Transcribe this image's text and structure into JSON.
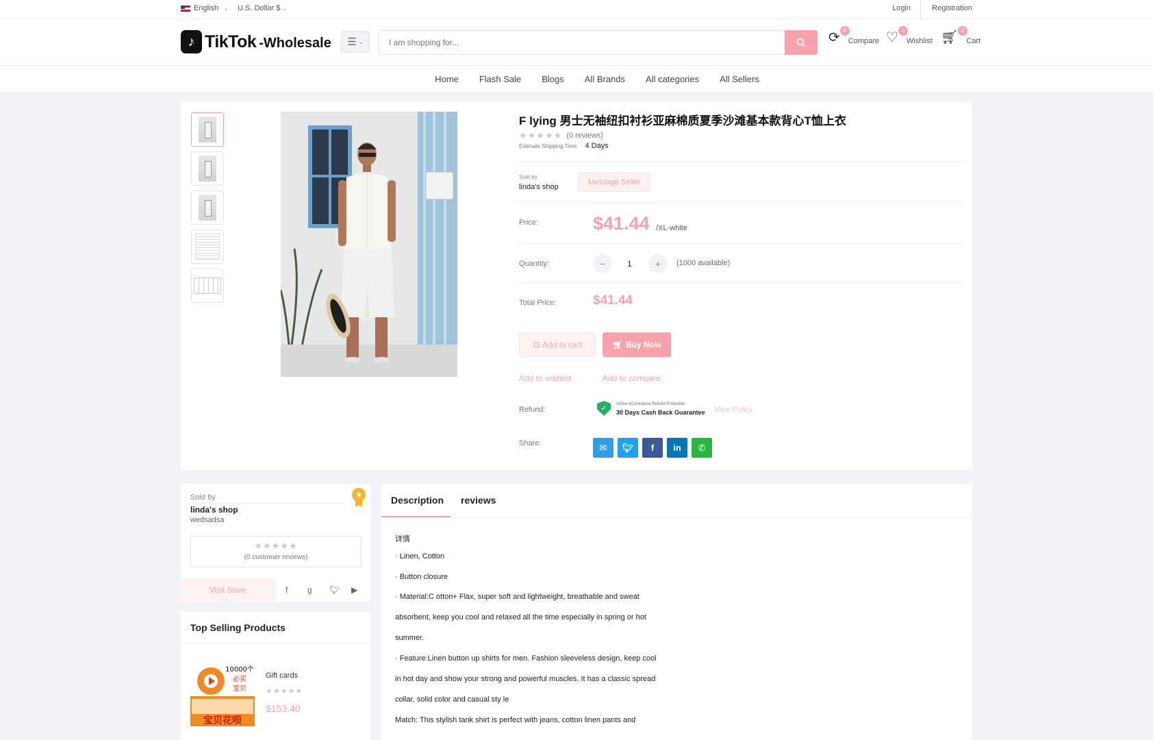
{
  "topbar": {
    "language": "English",
    "currency": "U.S. Dollar $",
    "login": "Login",
    "registration": "Registration"
  },
  "header": {
    "logo_main": "TikTok",
    "logo_sub": "-Wholesale",
    "search_placeholder": "I am shopping for...",
    "compare": {
      "label": "Compare",
      "count": "0"
    },
    "wishlist": {
      "label": "Wishlist",
      "count": "0"
    },
    "cart": {
      "label": "Cart",
      "count": "0"
    }
  },
  "nav": [
    "Home",
    "Flash Sale",
    "Blogs",
    "All Brands",
    "All categories",
    "All Sellers"
  ],
  "product": {
    "title": "F lying 男士无袖纽扣衬衫亚麻棉质夏季沙滩基本款背心T恤上衣",
    "stars": "★★★★★",
    "reviews": "(0 reviews)",
    "shipping_label": "Estimate Shipping Time:",
    "shipping_value": "4 Days",
    "sold_by_label": "Sold by:",
    "seller": "linda's shop",
    "message_seller": "Message Seller",
    "price_label": "Price:",
    "price": "$41.44",
    "variant": "/XL-white",
    "quantity_label": "Quantity:",
    "quantity": "1",
    "available": "(1000 available)",
    "total_label": "Total Price:",
    "total": "$41.44",
    "add_to_cart": "Add to cart",
    "buy_now": "Buy Now",
    "add_to_wishlist": "Add to wishlist",
    "add_to_compare": "Add to compare",
    "refund_label": "Refund:",
    "refund_small": "Active eCommerce Refund Protection",
    "refund_big": "30 Days Cash Back Guarantee",
    "view_policy": "View Policy",
    "share_label": "Share:"
  },
  "seller_card": {
    "sold_by": "Sold by",
    "name": "linda's shop",
    "sub": "wedsadsa",
    "stars": "★★★★★",
    "customer_reviews": "(0 customer reviews)",
    "visit_store": "Visit Store"
  },
  "top_selling": {
    "title": "Top Selling Products",
    "item": {
      "name": "Gift cards",
      "stars": "★★★★★",
      "price": "$153.40",
      "img_line1": "10000个",
      "img_line2": "必买",
      "img_line3": "宝贝",
      "img_line4": "宝贝花呗"
    }
  },
  "description": {
    "tab_desc": "Description",
    "tab_reviews": "reviews",
    "lines": [
      "详情",
      "· Linen, Cotton",
      "· Button closure",
      "· Material:C otton+ Flax, super soft and lightweight, breathable and sweat",
      "absorbent, keep you cool and relaxed all the time especially in spring or hot",
      "summer.",
      "·  Feature:Linen button up shirts for men. Fashion sleeveless design, keep cool",
      "in hot day and show your strong and powerful muscles. It has a classic spread",
      "collar, solid color and casual sty le",
      "Match: This stylish tank shirt is perfect with jeans, cotton linen pants and"
    ]
  },
  "colors": {
    "accent": "#f8a3ab",
    "share_email": "#2f9ee8",
    "share_twitter": "#1da1f2",
    "share_facebook": "#3b5998",
    "share_linkedin": "#0077b5",
    "share_whatsapp": "#2ab540"
  }
}
